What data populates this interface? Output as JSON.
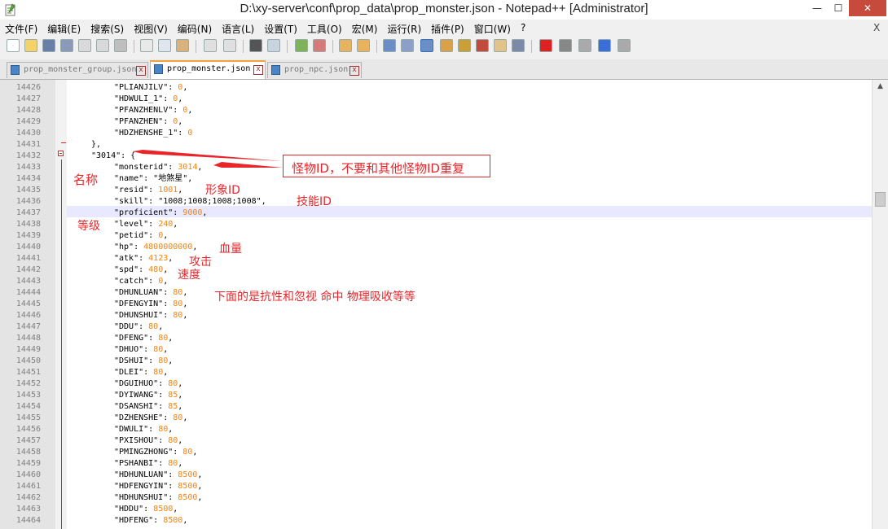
{
  "window": {
    "title": "D:\\xy-server\\conf\\prop_data\\prop_monster.json - Notepad++ [Administrator]",
    "minimize": "—",
    "maximize": "☐",
    "close": "✕"
  },
  "menu": {
    "items": [
      "文件(F)",
      "编辑(E)",
      "搜索(S)",
      "视图(V)",
      "编码(N)",
      "语言(L)",
      "设置(T)",
      "工具(O)",
      "宏(M)",
      "运行(R)",
      "插件(P)",
      "窗口(W)",
      "?"
    ],
    "close_x": "X"
  },
  "tabs": [
    {
      "label": "prop_monster_group.json",
      "active": false
    },
    {
      "label": "prop_monster.json",
      "active": true
    },
    {
      "label": "prop_npc.json",
      "active": false
    }
  ],
  "editor": {
    "lines": [
      {
        "no": "14426",
        "key": "\"PLIANJILV\"",
        "val": "0",
        "tail": ","
      },
      {
        "no": "14427",
        "key": "\"HDWULI_1\"",
        "val": "0",
        "tail": ","
      },
      {
        "no": "14428",
        "key": "\"PFANZHENLV\"",
        "val": "0",
        "tail": ","
      },
      {
        "no": "14429",
        "key": "\"PFANZHEN\"",
        "val": "0",
        "tail": ","
      },
      {
        "no": "14430",
        "key": "\"HDZHENSHE_1\"",
        "val": "0",
        "tail": ""
      },
      {
        "no": "14431",
        "raw": "},"
      },
      {
        "no": "14432",
        "raw": "\"3014\": {"
      },
      {
        "no": "14433",
        "key": "\"monsterid\"",
        "val": "3014",
        "tail": ","
      },
      {
        "no": "14434",
        "key": "\"name\"",
        "str": "\"地煞星\"",
        "tail": ","
      },
      {
        "no": "14435",
        "key": "\"resid\"",
        "val": "1001",
        "tail": ","
      },
      {
        "no": "14436",
        "key": "\"skill\"",
        "str": "\"1008;1008;1008;1008\"",
        "tail": ","
      },
      {
        "no": "14437",
        "key": "\"proficient\"",
        "val": "9000",
        "tail": ","
      },
      {
        "no": "14438",
        "key": "\"level\"",
        "val": "240",
        "tail": ","
      },
      {
        "no": "14439",
        "key": "\"petid\"",
        "val": "0",
        "tail": ","
      },
      {
        "no": "14440",
        "key": "\"hp\"",
        "val": "4800000000",
        "tail": ","
      },
      {
        "no": "14441",
        "key": "\"atk\"",
        "val": "4123",
        "tail": ","
      },
      {
        "no": "14442",
        "key": "\"spd\"",
        "val": "480",
        "tail": ","
      },
      {
        "no": "14443",
        "key": "\"catch\"",
        "val": "0",
        "tail": ","
      },
      {
        "no": "14444",
        "key": "\"DHUNLUAN\"",
        "val": "80",
        "tail": ","
      },
      {
        "no": "14445",
        "key": "\"DFENGYIN\"",
        "val": "80",
        "tail": ","
      },
      {
        "no": "14446",
        "key": "\"DHUNSHUI\"",
        "val": "80",
        "tail": ","
      },
      {
        "no": "14447",
        "key": "\"DDU\"",
        "val": "80",
        "tail": ","
      },
      {
        "no": "14448",
        "key": "\"DFENG\"",
        "val": "80",
        "tail": ","
      },
      {
        "no": "14449",
        "key": "\"DHUO\"",
        "val": "80",
        "tail": ","
      },
      {
        "no": "14450",
        "key": "\"DSHUI\"",
        "val": "80",
        "tail": ","
      },
      {
        "no": "14451",
        "key": "\"DLEI\"",
        "val": "80",
        "tail": ","
      },
      {
        "no": "14452",
        "key": "\"DGUIHUO\"",
        "val": "80",
        "tail": ","
      },
      {
        "no": "14453",
        "key": "\"DYIWANG\"",
        "val": "85",
        "tail": ","
      },
      {
        "no": "14454",
        "key": "\"DSANSHI\"",
        "val": "85",
        "tail": ","
      },
      {
        "no": "14455",
        "key": "\"DZHENSHE\"",
        "val": "80",
        "tail": ","
      },
      {
        "no": "14456",
        "key": "\"DWULI\"",
        "val": "80",
        "tail": ","
      },
      {
        "no": "14457",
        "key": "\"PXISHOU\"",
        "val": "80",
        "tail": ","
      },
      {
        "no": "14458",
        "key": "\"PMINGZHONG\"",
        "val": "80",
        "tail": ","
      },
      {
        "no": "14459",
        "key": "\"PSHANBI\"",
        "val": "80",
        "tail": ","
      },
      {
        "no": "14460",
        "key": "\"HDHUNLUAN\"",
        "val": "8500",
        "tail": ","
      },
      {
        "no": "14461",
        "key": "\"HDFENGYIN\"",
        "val": "8500",
        "tail": ","
      },
      {
        "no": "14462",
        "key": "\"HDHUNSHUI\"",
        "val": "8500",
        "tail": ","
      },
      {
        "no": "14463",
        "key": "\"HDDU\"",
        "val": "8500",
        "tail": ","
      },
      {
        "no": "14464",
        "key": "\"HDFENG\"",
        "val": "8500",
        "tail": ","
      }
    ]
  },
  "annotations": {
    "monster_id": "怪物ID，不要和其他怪物ID重复",
    "name": "名称",
    "resid": "形象ID",
    "skill": "技能ID",
    "level": "等级",
    "hp": "血量",
    "atk": "攻击",
    "spd": "速度",
    "resist": "下面的是抗性和忽视 命中 物理吸收等等"
  },
  "colors": {
    "annotation": "#e8262a",
    "number": "#ff8000",
    "current_line": "#e8e8ff",
    "active_tab_accent": "#f3a33c"
  }
}
